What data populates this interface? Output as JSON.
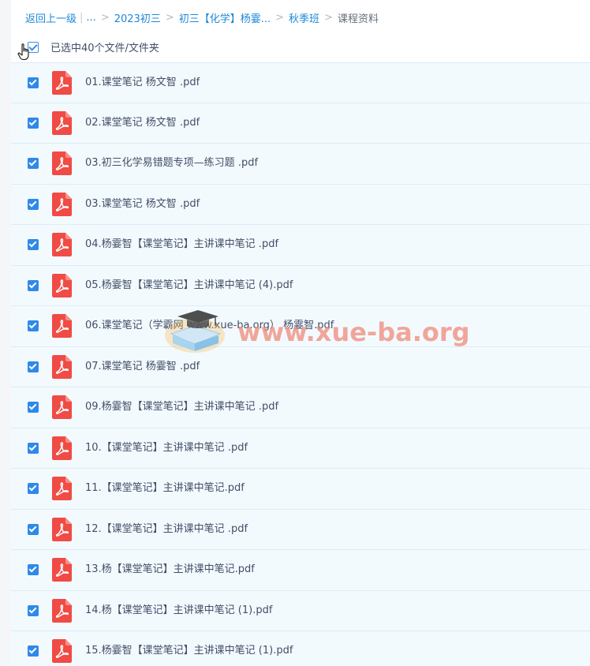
{
  "breadcrumb": {
    "back": "返回上一级",
    "ellipsis": "...",
    "items": [
      "2023初三",
      "初三【化学】杨霎...",
      "秋季班"
    ],
    "current": "课程资料"
  },
  "selection": {
    "label": "已选中40个文件/文件夹"
  },
  "files": [
    {
      "name": "01.课堂笔记 杨文智 .pdf",
      "icon": "pdf-icon"
    },
    {
      "name": "02.课堂笔记 杨文智 .pdf",
      "icon": "pdf-icon"
    },
    {
      "name": "03.初三化学易错题专项—练习题 .pdf",
      "icon": "pdf-icon"
    },
    {
      "name": "03.课堂笔记 杨文智 .pdf",
      "icon": "pdf-icon"
    },
    {
      "name": "04.杨霎智【课堂笔记】主讲课中笔记 .pdf",
      "icon": "pdf-icon"
    },
    {
      "name": "05.杨霎智【课堂笔记】主讲课中笔记 (4).pdf",
      "icon": "pdf-icon"
    },
    {
      "name": "06.课堂笔记（学霸网 www.xue-ba.org） 杨霎智.pdf",
      "icon": "pdf-icon"
    },
    {
      "name": "07.课堂笔记 杨霎智 .pdf",
      "icon": "pdf-icon"
    },
    {
      "name": "09.杨霎智【课堂笔记】主讲课中笔记 .pdf",
      "icon": "pdf-icon"
    },
    {
      "name": "10.【课堂笔记】主讲课中笔记 .pdf",
      "icon": "pdf-icon"
    },
    {
      "name": "11.【课堂笔记】主讲课中笔记.pdf",
      "icon": "pdf-icon"
    },
    {
      "name": "12.【课堂笔记】主讲课中笔记 .pdf",
      "icon": "pdf-icon"
    },
    {
      "name": "13.杨【课堂笔记】主讲课中笔记.pdf",
      "icon": "pdf-icon"
    },
    {
      "name": "14.杨【课堂笔记】主讲课中笔记 (1).pdf",
      "icon": "pdf-icon"
    },
    {
      "name": "15.杨霎智【课堂笔记】主讲课中笔记 (1).pdf",
      "icon": "pdf-icon"
    }
  ],
  "watermark": {
    "text": "www.xue-ba.org",
    "color": "#f08c7c"
  },
  "colors": {
    "link": "#1e88d8",
    "row_bg": "#f3fafe",
    "check": "#2f89e8",
    "pdf_red": "#f04b45"
  }
}
